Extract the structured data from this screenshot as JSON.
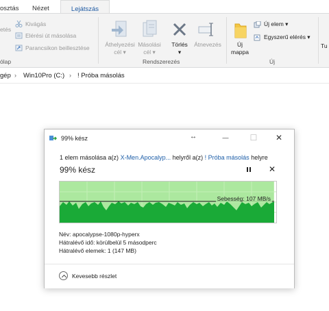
{
  "ribbon": {
    "tabs": [
      {
        "label": "osztás"
      },
      {
        "label": "Nézet"
      },
      {
        "label": "Lejátszás"
      }
    ],
    "clipboard": {
      "cut_partial": "etés",
      "cut": "Kivágás",
      "copy_path": "Elérési út másolása",
      "paste_shortcut": "Parancsikon beillesztése",
      "group_label": "ólap"
    },
    "organize": {
      "move_to": "Áthelyezési\ncél ▾",
      "copy_to": "Másolási\ncél ▾",
      "delete": "Törlés\n▾",
      "rename": "Átnevezés",
      "group_label": "Rendszerezés"
    },
    "new": {
      "new_folder": "Új\nmappa",
      "new_item": "Új elem ▾",
      "easy_access": "Egyszerű elérés ▾",
      "group_label": "Új"
    },
    "properties_partial": "Tu"
  },
  "address": {
    "crumbs": [
      "gép",
      "Win10Pro (C:)",
      "! Próba másolás"
    ]
  },
  "dialog": {
    "title": "99% kész",
    "resize_glyph": "↔",
    "minimize": "—",
    "maximize": "☐",
    "close": "✕",
    "status_prefix": "1 elem másolása a(z)",
    "source": "X-Men.Apocalyp...",
    "status_middle": "helyről a(z)",
    "destination": "! Próba másolás",
    "status_suffix": "helyre",
    "progress_title": "99% kész",
    "progress": 99,
    "cancel_glyph": "✕",
    "speed_label": "Sebesség: 107 MB/s",
    "name_line": "Név:  apocalypse-1080p-hyperx",
    "time_line": "Hátralévő idő:  körülbelül 5 másodperc",
    "items_line": "Hátralévő elemek:  1 (147 MB)",
    "less_details": "Kevesebb részlet"
  },
  "colors": {
    "graph_fill": "#1aaa37",
    "graph_bg": "#ace89f",
    "link": "#1d5ea8"
  }
}
